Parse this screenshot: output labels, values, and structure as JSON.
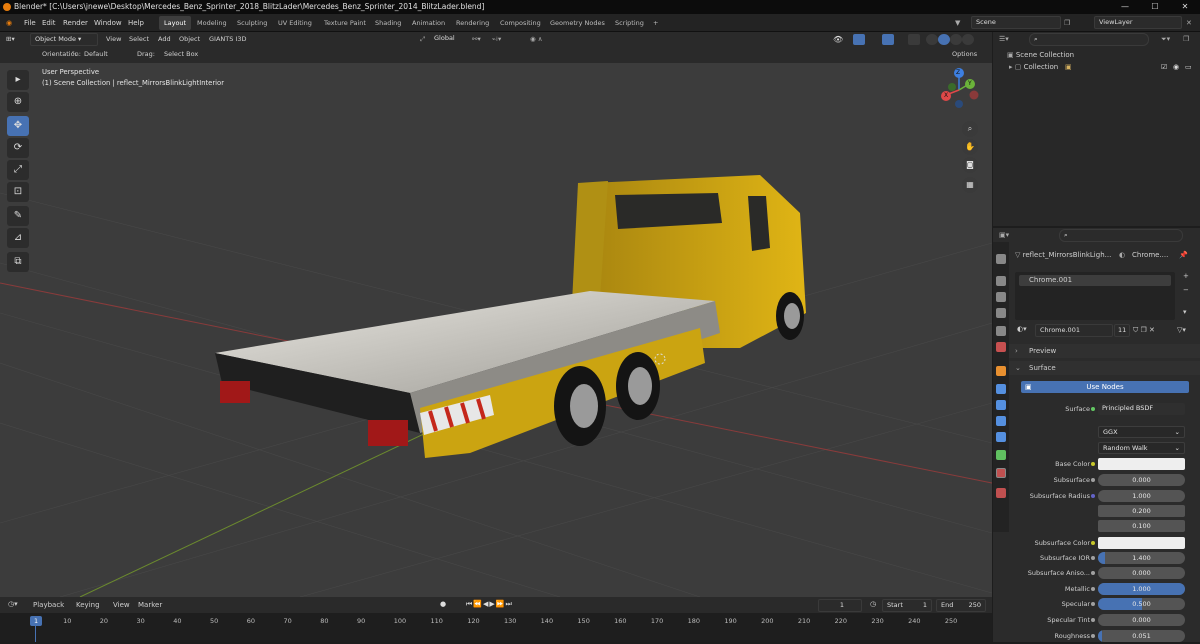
{
  "titlebar": {
    "title": "Blender* [C:\\Users\\jnewe\\Desktop\\Mercedes_Benz_Sprinter_2018_BlitzLader\\Mercedes_Benz_Sprinter_2014_BlitzLader.blend]",
    "min": "—",
    "max": "☐",
    "close": "✕"
  },
  "menu": [
    "File",
    "Edit",
    "Render",
    "Window",
    "Help"
  ],
  "workspaces": [
    "Layout",
    "Modeling",
    "Sculpting",
    "UV Editing",
    "Texture Paint",
    "Shading",
    "Animation",
    "Rendering",
    "Compositing",
    "Geometry Nodes",
    "Scripting",
    "+"
  ],
  "scene": {
    "label": "Scene",
    "viewlayer": "ViewLayer"
  },
  "header": {
    "mode": "Object Mode",
    "view": "View",
    "select": "Select",
    "add": "Add",
    "object": "Object",
    "addon": "GIANTS I3D",
    "transform": "Global",
    "orientation_label": "Orientation:",
    "orientation_value": "Default",
    "drag_label": "Drag:",
    "drag_value": "Select Box",
    "options": "Options"
  },
  "viewport": {
    "line1": "User Perspective",
    "line2": "(1) Scene Collection | reflect_MirrorsBlinkLightInterior"
  },
  "gizmo": {
    "x": "X",
    "y": "Y",
    "z": "Z"
  },
  "outliner": {
    "scene_collection": "Scene Collection",
    "collection": "Collection"
  },
  "props": {
    "object_name": "reflect_MirrorsBlinkLigh...",
    "material_tab": "Chrome....",
    "slot": "Chrome.001",
    "material_name": "Chrome.001",
    "users": "11",
    "preview": "Preview",
    "surface_section": "Surface",
    "use_nodes": "Use Nodes",
    "surface_label": "Surface",
    "surface_value": "Principled BSDF",
    "distribution": "GGX",
    "sss_method": "Random Walk",
    "rows": [
      {
        "label": "Base Color",
        "value": "",
        "type": "color",
        "color": "#eeeeee"
      },
      {
        "label": "Subsurface",
        "value": "0.000",
        "fill": 0
      },
      {
        "label": "Subsurface Radius",
        "value": "1.000",
        "fill": 0
      },
      {
        "label": "",
        "value": "0.200",
        "fill": 0
      },
      {
        "label": "",
        "value": "0.100",
        "fill": 0
      },
      {
        "label": "Subsurface Color",
        "value": "",
        "type": "color",
        "color": "#eeeeee"
      },
      {
        "label": "Subsurface IOR",
        "value": "1.400",
        "fill": 0.08
      },
      {
        "label": "Subsurface Aniso...",
        "value": "0.000",
        "fill": 0
      },
      {
        "label": "Metallic",
        "value": "1.000",
        "fill": 1
      },
      {
        "label": "Specular",
        "value": "0.500",
        "fill": 0.5
      },
      {
        "label": "Specular Tint",
        "value": "0.000",
        "fill": 0
      },
      {
        "label": "Roughness",
        "value": "0.051",
        "fill": 0.051
      }
    ]
  },
  "timeline": {
    "playback": "Playback",
    "keying": "Keying",
    "view": "View",
    "marker": "Marker",
    "current": "1",
    "start_label": "Start",
    "start": "1",
    "end_label": "End",
    "end": "250",
    "ticks": [
      "1",
      "10",
      "20",
      "30",
      "40",
      "50",
      "60",
      "70",
      "80",
      "90",
      "100",
      "110",
      "120",
      "130",
      "140",
      "150",
      "160",
      "170",
      "180",
      "190",
      "200",
      "210",
      "220",
      "230",
      "240",
      "250"
    ]
  },
  "colors": {
    "accent": "#4772b3",
    "truck": "#c9a20d",
    "viewport": "#3c3c3c"
  }
}
